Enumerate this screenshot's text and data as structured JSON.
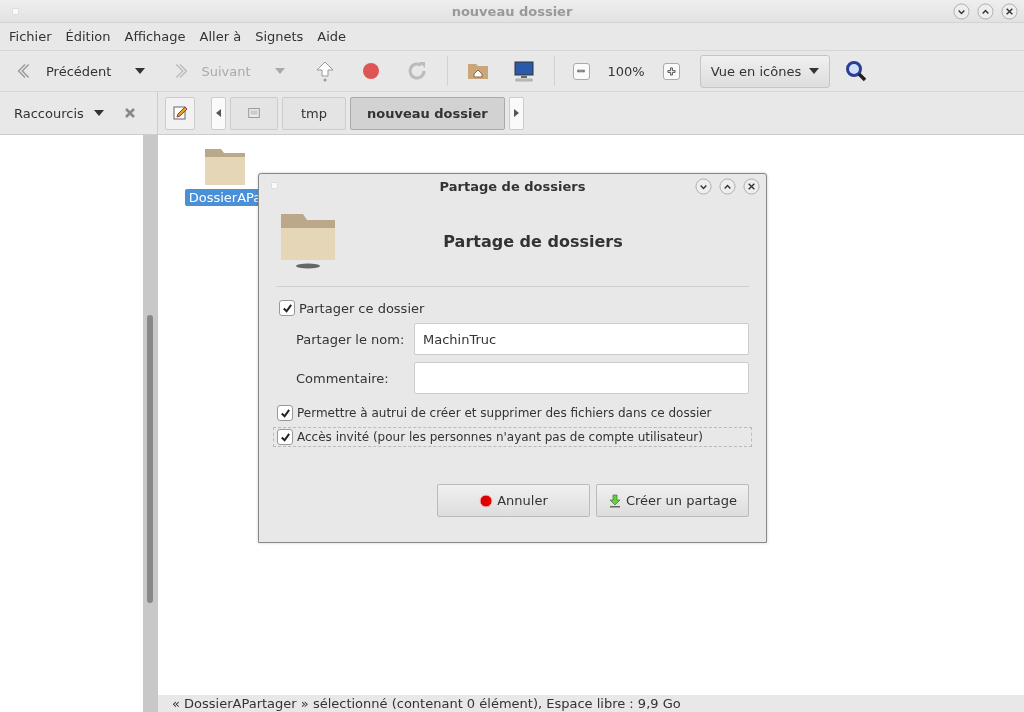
{
  "window": {
    "title": "nouveau dossier"
  },
  "menu": [
    "Fichier",
    "Édition",
    "Affichage",
    "Aller à",
    "Signets",
    "Aide"
  ],
  "toolbar": {
    "back": {
      "label": "Précédent",
      "disabled": false
    },
    "forward": {
      "label": "Suivant",
      "disabled": true
    },
    "zoom": "100%",
    "view": "Vue en icônes"
  },
  "sidebar": {
    "title": "Raccourcis"
  },
  "path": [
    {
      "kind": "root",
      "selected": false
    },
    {
      "kind": "text",
      "label": "tmp",
      "selected": false
    },
    {
      "kind": "text",
      "label": "nouveau dossier",
      "selected": true
    }
  ],
  "files": [
    {
      "name": "DossierAPa",
      "selected": true
    }
  ],
  "status_bar": "« DossierAPartager » sélectionné (contenant 0 élément), Espace libre : 9,9 Go",
  "dialog": {
    "title": "Partage de dossiers",
    "heading": "Partage de dossiers",
    "share": {
      "label": "Partager ce dossier",
      "checked": true
    },
    "fields": [
      {
        "label": "Partager le nom:",
        "value": "MachinTruc"
      },
      {
        "label": "Commentaire:"
      }
    ],
    "options": [
      {
        "label": "Permettre à autrui de créer et supprimer des fichiers dans ce dossier",
        "checked": true,
        "focused": false
      },
      {
        "label": "Accès invité (pour les personnes n'ayant pas de compte utilisateur)",
        "checked": true,
        "focused": true
      }
    ],
    "buttons": [
      {
        "kind": "cancel",
        "label": "Annuler"
      },
      {
        "kind": "create",
        "label": "Créer un partage"
      }
    ]
  }
}
